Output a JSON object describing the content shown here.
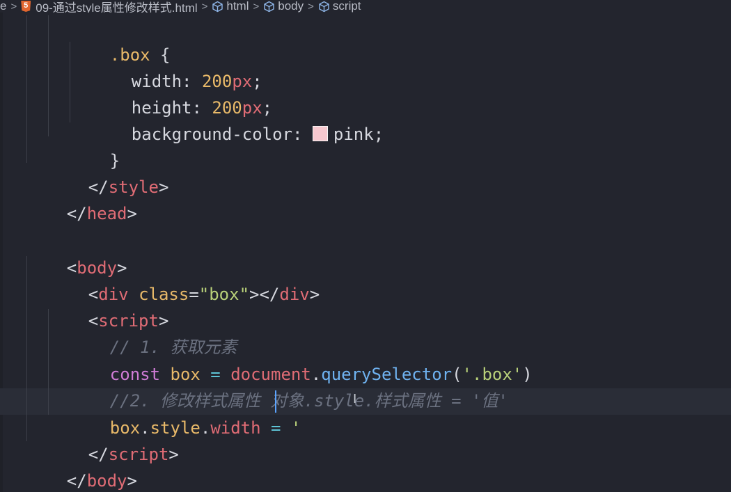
{
  "breadcrumb": {
    "items": [
      {
        "label": "e",
        "icon": "none"
      },
      {
        "label": "09-通过style属性修改样式.html",
        "icon": "html5-icon"
      },
      {
        "label": "html",
        "icon": "cube-icon"
      },
      {
        "label": "body",
        "icon": "cube-icon"
      },
      {
        "label": "script",
        "icon": "cube-icon"
      }
    ],
    "separator": ">"
  },
  "code": {
    "l1_sel": ".box",
    "l1_brace": " {",
    "l2_prop": "width",
    "l2_colon": ": ",
    "l2_num": "200",
    "l2_unit": "px",
    "l2_semi": ";",
    "l3_prop": "height",
    "l3_colon": ": ",
    "l3_num": "200",
    "l3_unit": "px",
    "l3_semi": ";",
    "l4_prop": "background-color",
    "l4_colon": ": ",
    "l4_val": "pink",
    "l4_semi": ";",
    "l4_swatch_color": "#f7c8cf",
    "l5_brace": "}",
    "l6_open": "</",
    "l6_tag": "style",
    "l6_close": ">",
    "l7_open": "</",
    "l7_tag": "head",
    "l7_close": ">",
    "l9_open": "<",
    "l9_tag": "body",
    "l9_close": ">",
    "l10_open": "<",
    "l10_tag": "div",
    "l10_sp": " ",
    "l10_attr": "class",
    "l10_eq": "=",
    "l10_str": "\"box\"",
    "l10_gt": "></",
    "l10_tag2": "div",
    "l10_close": ">",
    "l11_open": "<",
    "l11_tag": "script",
    "l11_close": ">",
    "l12_comment": "// 1. 获取元素",
    "l13_kw": "const",
    "l13_var": " box",
    "l13_eq": " = ",
    "l13_obj": "document",
    "l13_dot": ".",
    "l13_fn": "querySelector",
    "l13_paren": "(",
    "l13_str": "'.box'",
    "l13_paren2": ")",
    "l14_comment": "//2. 修改样式属性 对象.style.样式属性 = '值'",
    "l15_var": "box",
    "l15_dot1": ".",
    "l15_style": "style",
    "l15_dot2": ".",
    "l15_width": "width",
    "l15_eq": " = ",
    "l15_str": "'",
    "l16_open": "</",
    "l16_tag": "script",
    "l16_close": ">",
    "l17_open": "</",
    "l17_tag": "body",
    "l17_close": ">"
  },
  "cursor": {
    "ibeam_glyph": "I"
  },
  "colors": {
    "background": "#23252e",
    "tag": "#e06c75",
    "attribute": "#e8b969",
    "string": "#b9d17a",
    "keyword": "#d07cd6",
    "function": "#6fb2f0",
    "comment": "#6b7180",
    "caret": "#5ba4ff"
  }
}
